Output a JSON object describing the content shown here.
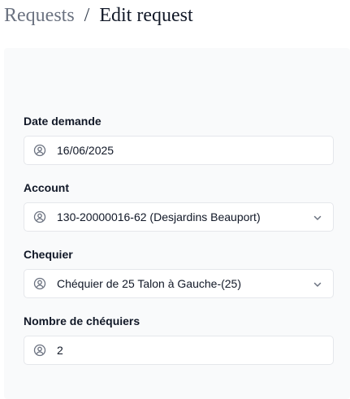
{
  "breadcrumb": {
    "parent": "Requests",
    "separator": "/",
    "current": "Edit request"
  },
  "form": {
    "date_demande": {
      "label": "Date demande",
      "value": "16/06/2025",
      "icon": "user-circle-icon"
    },
    "account": {
      "label": "Account",
      "value": "130-20000016-62 (Desjardins Beauport)",
      "icon": "user-circle-icon"
    },
    "chequier": {
      "label": "Chequier",
      "value": "Chéquier de 25 Talon à Gauche-(25)",
      "icon": "user-circle-icon"
    },
    "nombre_chequiers": {
      "label": "Nombre de chéquiers",
      "value": "2",
      "icon": "user-circle-icon"
    }
  },
  "colors": {
    "card_background": "#f9fafb",
    "field_border": "#e5e7eb",
    "breadcrumb_parent": "#6b7280",
    "text": "#111827"
  }
}
